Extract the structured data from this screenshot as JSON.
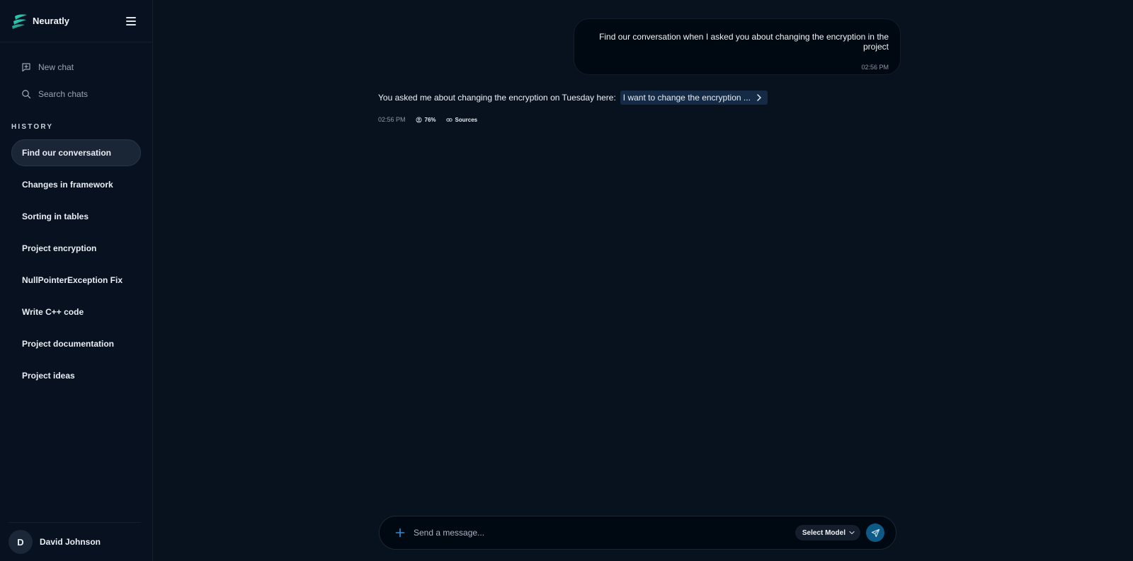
{
  "app": {
    "name": "Neuratly"
  },
  "sidebar": {
    "actions": [
      {
        "label": "New chat",
        "icon": "new-chat-icon"
      },
      {
        "label": "Search chats",
        "icon": "search-icon"
      }
    ],
    "history_label": "HISTORY",
    "history": [
      {
        "label": "Find our conversation",
        "active": true
      },
      {
        "label": "Changes in framework"
      },
      {
        "label": "Sorting in tables"
      },
      {
        "label": "Project encryption"
      },
      {
        "label": "NullPointerException Fix"
      },
      {
        "label": "Write C++ code"
      },
      {
        "label": "Project documentation"
      },
      {
        "label": "Project ideas"
      }
    ],
    "user": {
      "initial": "D",
      "name": "David Johnson"
    }
  },
  "conversation": {
    "user_message": {
      "text": "Find our conversation when I asked you about changing the encryption in the project",
      "time": "02:56 PM"
    },
    "assistant_message": {
      "text": "You asked me about changing the encryption on Tuesday here:",
      "reference": "I want to change the encryption ...",
      "time": "02:56 PM",
      "confidence": "76%",
      "sources_label": "Sources"
    }
  },
  "composer": {
    "placeholder": "Send a message...",
    "value": "",
    "model_label": "Select Model"
  },
  "colors": {
    "background": "#08121f",
    "accent": "#0e5a86",
    "logo_gradient": [
      "#2fd3a6",
      "#1a8f9e"
    ]
  }
}
